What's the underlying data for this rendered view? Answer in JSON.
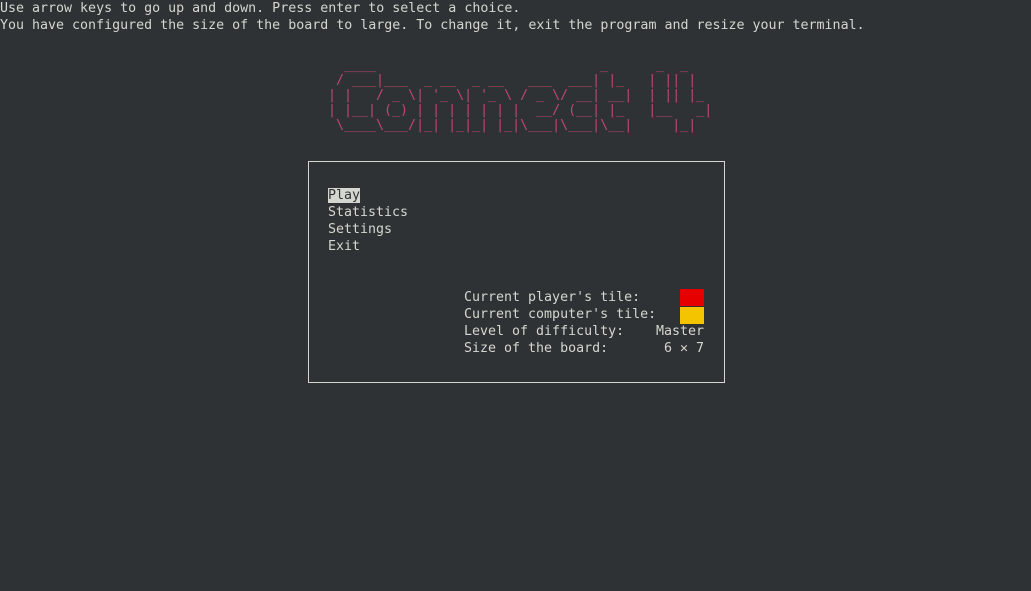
{
  "instructions": {
    "line1": "Use arrow keys to go up and down. Press enter to select a choice.",
    "line2": "You have configured the size of the board to large. To change it, exit the program and resize your terminal."
  },
  "banner": {
    "ascii_art": "   ____                            _      _  _   \n  / ___|___  _ __  _ __   ___  ___| |_   | || |  \n | |   / _ \\| '_ \\| '_ \\ / _ \\/ __| __|  | || |_ \n | |__| (_) | | | | | | |  __/ (__| |_   |__   _|\n  \\____\\___/|_| |_|_| |_|\\___|\\___|\\__|     |_|  ",
    "color": "#c0486e"
  },
  "menu": {
    "items": [
      "Play",
      "Statistics",
      "Settings",
      "Exit"
    ],
    "selected_index": 0
  },
  "info": {
    "player_tile_label": "Current player's tile:",
    "computer_tile_label": "Current computer's tile:",
    "difficulty_label": "Level of difficulty:",
    "difficulty_value": "Master",
    "board_size_label": "Size of the board:",
    "board_size_value": "6 ✕ 7",
    "player_tile_color": "#e60000",
    "computer_tile_color": "#f5c400"
  },
  "colors": {
    "background": "#2e3234",
    "foreground": "#d3d7cf"
  }
}
